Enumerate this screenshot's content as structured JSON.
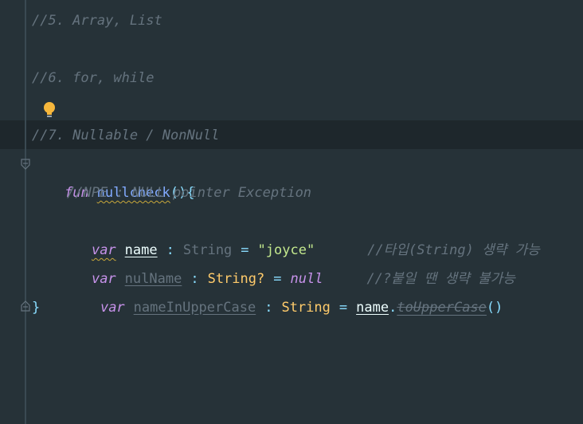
{
  "lines": {
    "l1": "//5. Array, List",
    "l2": "//6. for, while",
    "l3": "//7. Nullable / NonNull",
    "l4": {
      "kw": "fun",
      "name": "nullcheck",
      "punc": "(){"
    },
    "l5": "//NPE : NULL pointer Exception",
    "l6": {
      "kw": "var",
      "name": "name",
      "colon": ":",
      "type": "String",
      "eq": "=",
      "value": "\"joyce\"",
      "comment": "//타입(String) 생략 가능"
    },
    "l7": {
      "kw": "var",
      "name": "nulName",
      "colon": ":",
      "type": "String?",
      "eq": "=",
      "value": "null",
      "comment": "//?붙일 땐 생략 불가능"
    },
    "l8": {
      "kw": "var",
      "name": "nameInUpperCase",
      "colon": ":",
      "type": "String",
      "eq": "=",
      "recv": "name",
      "dot": ".",
      "method": "toUpperCase",
      "parens": "()"
    },
    "l9": "}"
  },
  "icons": {
    "bulb": "lightbulb-icon",
    "fold": "fold-icon"
  },
  "colors": {
    "background": "#263238",
    "current_line": "#1e272c",
    "comment": "#65737e",
    "keyword": "#c792ea",
    "function": "#82aaff",
    "type": "#ffcb6b",
    "string": "#c3e88d",
    "bulb": "#f6b73c"
  }
}
